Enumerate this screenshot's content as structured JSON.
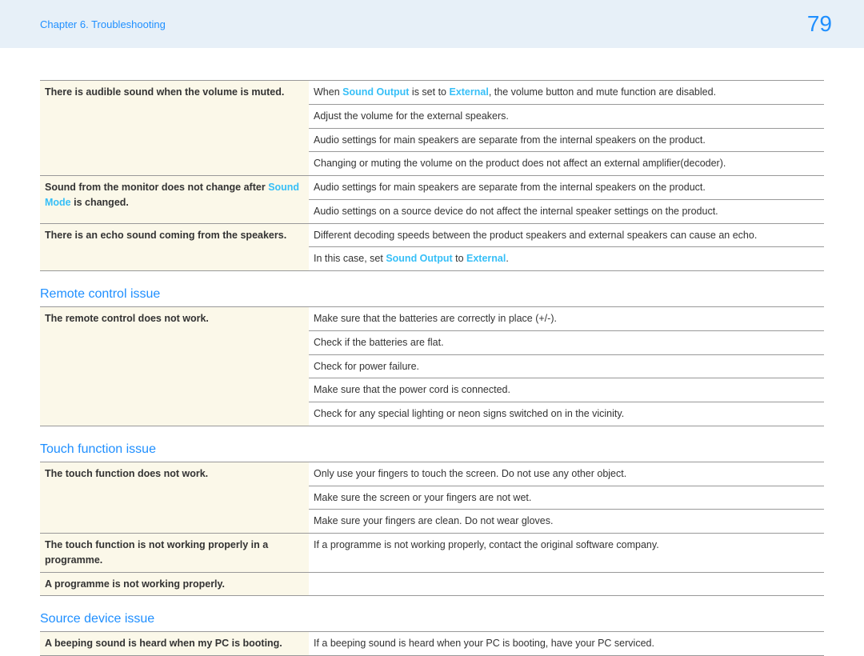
{
  "header": {
    "chapter": "Chapter 6. Troubleshooting",
    "page": "79"
  },
  "links": {
    "sound_output": "Sound Output",
    "external": "External",
    "sound_mode": "Sound Mode"
  },
  "sections": [
    {
      "key": "audio",
      "heading": null,
      "rows": [
        {
          "issue_pre": "There is audible sound when the volume is muted.",
          "issue_link": "",
          "issue_post": "",
          "answers": [
            {
              "pre": "When ",
              "link": "Sound Output",
              "mid": " is set to ",
              "link2": "External",
              "post": ", the volume button and mute function are disabled."
            },
            {
              "pre": "Adjust the volume for the external speakers.",
              "link": "",
              "mid": "",
              "link2": "",
              "post": ""
            },
            {
              "pre": "Audio settings for main speakers are separate from the internal speakers on the product.",
              "link": "",
              "mid": "",
              "link2": "",
              "post": ""
            },
            {
              "pre": "Changing or muting the volume on the product does not affect an external amplifier(decoder).",
              "link": "",
              "mid": "",
              "link2": "",
              "post": ""
            }
          ]
        },
        {
          "issue_pre": "Sound from the monitor does not change after ",
          "issue_link": "Sound Mode",
          "issue_post": " is changed.",
          "answers": [
            {
              "pre": "Audio settings for main speakers are separate from the internal speakers on the product.",
              "link": "",
              "mid": "",
              "link2": "",
              "post": ""
            },
            {
              "pre": "Audio settings on a source device do not affect the internal speaker settings on the product.",
              "link": "",
              "mid": "",
              "link2": "",
              "post": ""
            }
          ]
        },
        {
          "issue_pre": "There is an echo sound coming from the speakers.",
          "issue_link": "",
          "issue_post": "",
          "answers": [
            {
              "pre": "Different decoding speeds between the product speakers and external speakers can cause an echo.",
              "link": "",
              "mid": "",
              "link2": "",
              "post": ""
            },
            {
              "pre": "In this case, set ",
              "link": "Sound Output",
              "mid": " to ",
              "link2": "External",
              "post": "."
            }
          ]
        }
      ]
    },
    {
      "key": "remote",
      "heading": "Remote control issue",
      "rows": [
        {
          "issue_pre": "The remote control does not work.",
          "issue_link": "",
          "issue_post": "",
          "answers": [
            {
              "pre": "Make sure that the batteries are correctly in place (+/-).",
              "link": "",
              "mid": "",
              "link2": "",
              "post": ""
            },
            {
              "pre": "Check if the batteries are flat.",
              "link": "",
              "mid": "",
              "link2": "",
              "post": ""
            },
            {
              "pre": "Check for power failure.",
              "link": "",
              "mid": "",
              "link2": "",
              "post": ""
            },
            {
              "pre": "Make sure that the power cord is connected.",
              "link": "",
              "mid": "",
              "link2": "",
              "post": ""
            },
            {
              "pre": "Check for any special lighting or neon signs switched on in the vicinity.",
              "link": "",
              "mid": "",
              "link2": "",
              "post": ""
            }
          ]
        }
      ]
    },
    {
      "key": "touch",
      "heading": "Touch function issue",
      "rows": [
        {
          "issue_pre": "The touch function does not work.",
          "issue_link": "",
          "issue_post": "",
          "answers": [
            {
              "pre": "Only use your fingers to touch the screen. Do not use any other object.",
              "link": "",
              "mid": "",
              "link2": "",
              "post": ""
            },
            {
              "pre": "Make sure the screen or your fingers are not wet.",
              "link": "",
              "mid": "",
              "link2": "",
              "post": ""
            },
            {
              "pre": "Make sure your fingers are clean. Do not wear gloves.",
              "link": "",
              "mid": "",
              "link2": "",
              "post": ""
            }
          ]
        },
        {
          "issue_pre": "The touch function is not working properly in a programme.",
          "issue_link": "",
          "issue_post": "",
          "answers": [
            {
              "pre": "If a programme is not working properly, contact the original software company.",
              "link": "",
              "mid": "",
              "link2": "",
              "post": ""
            }
          ]
        },
        {
          "issue_pre": "A programme is not working properly.",
          "issue_link": "",
          "issue_post": "",
          "answers": [
            {
              "pre": "",
              "link": "",
              "mid": "",
              "link2": "",
              "post": ""
            }
          ]
        }
      ]
    },
    {
      "key": "source",
      "heading": "Source device issue",
      "rows": [
        {
          "issue_pre": "A beeping sound is heard when my PC is booting.",
          "issue_link": "",
          "issue_post": "",
          "answers": [
            {
              "pre": "If a beeping sound is heard when your PC is booting, have your PC serviced.",
              "link": "",
              "mid": "",
              "link2": "",
              "post": ""
            }
          ]
        }
      ]
    }
  ]
}
